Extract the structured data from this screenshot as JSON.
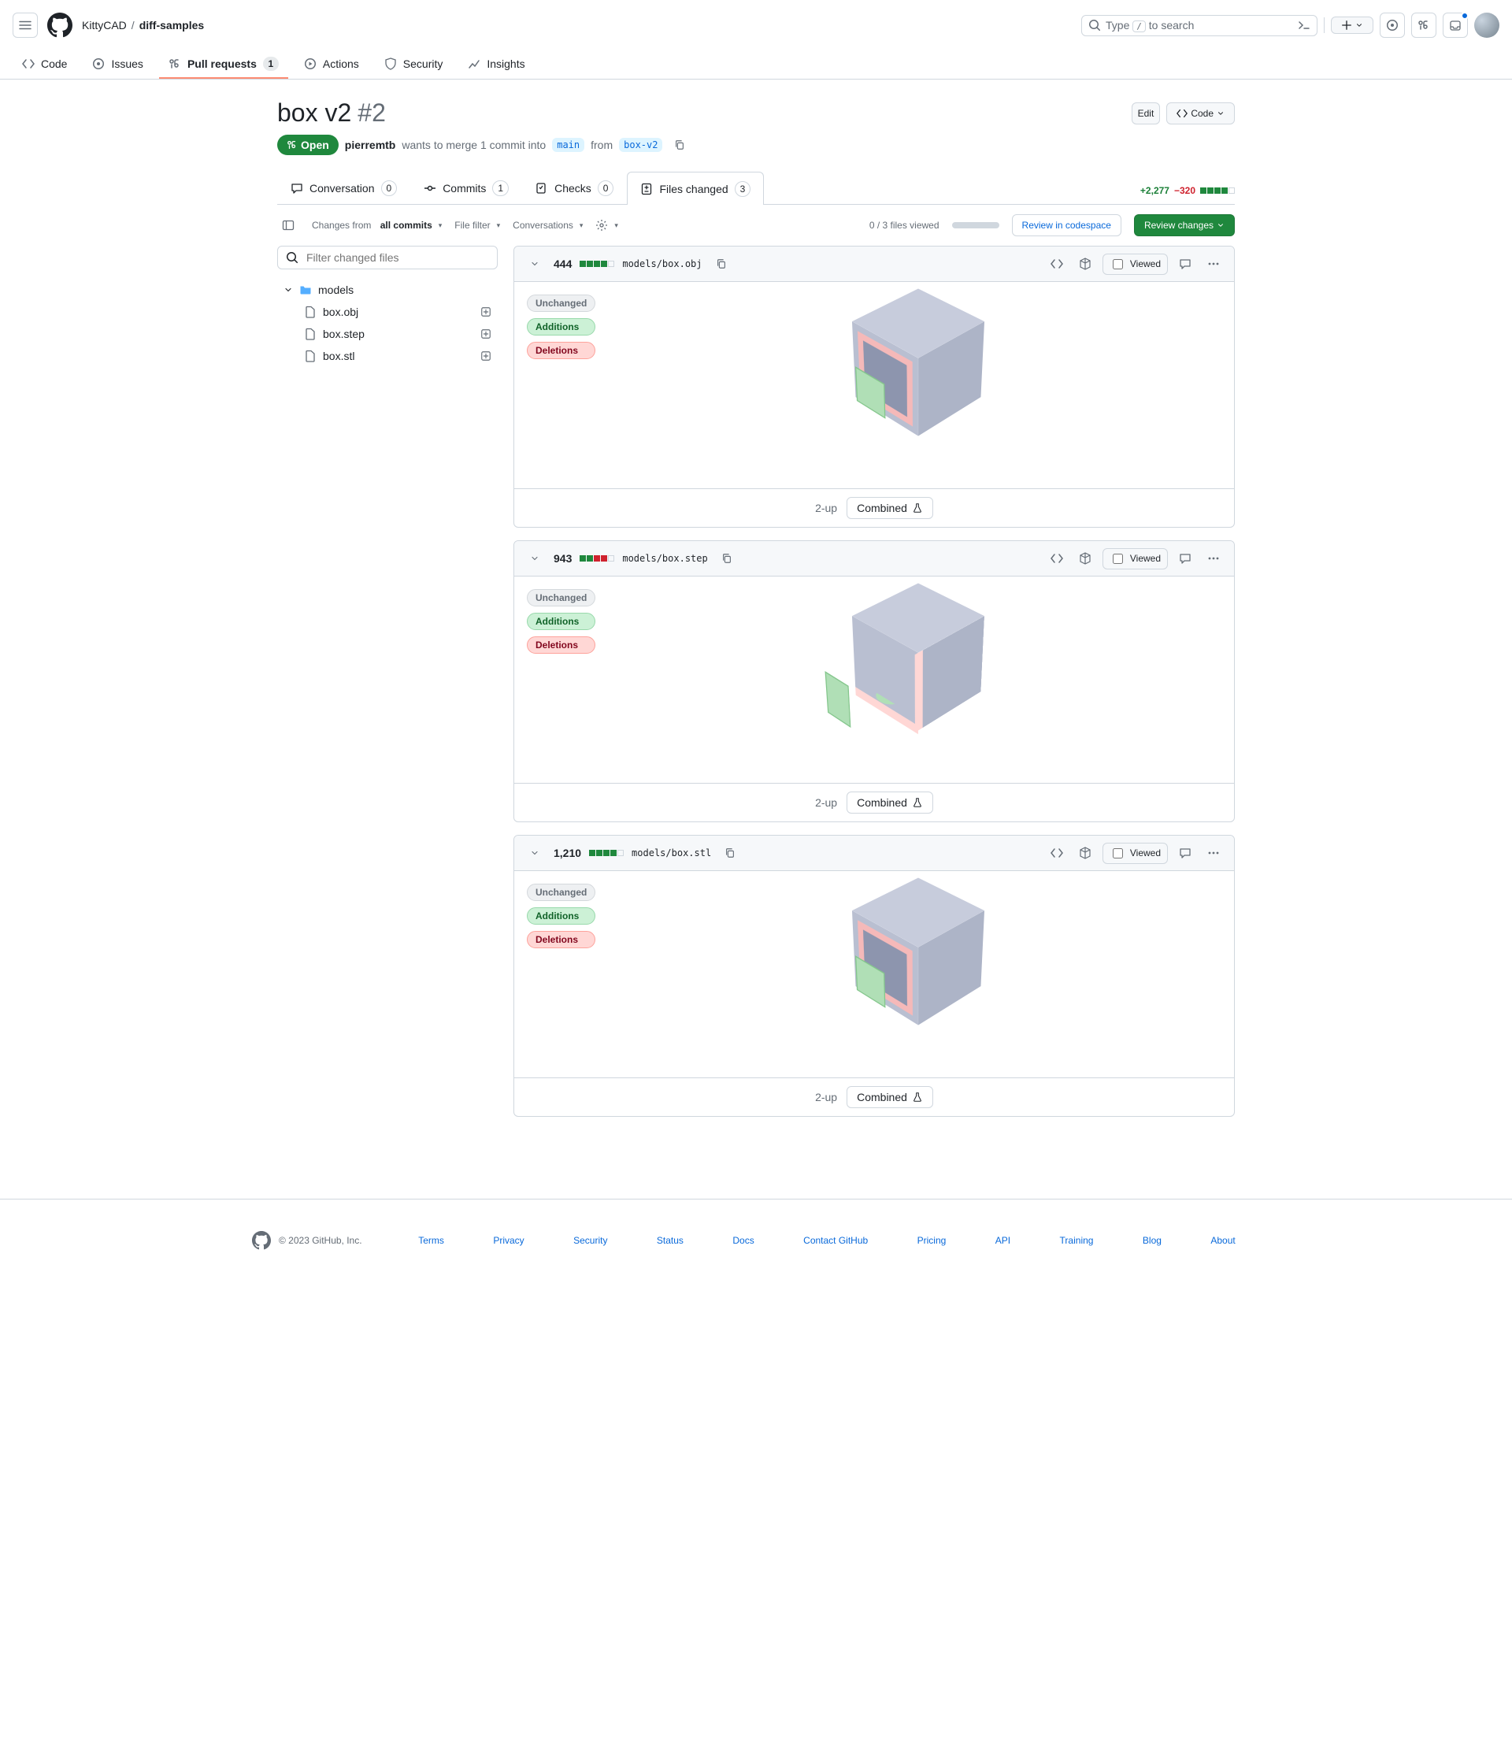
{
  "header": {
    "owner": "KittyCAD",
    "repo": "diff-samples",
    "search_prefix": "Type",
    "search_key": "/",
    "search_suffix": "to search"
  },
  "repo_nav": {
    "code": "Code",
    "issues": "Issues",
    "pulls": "Pull requests",
    "pulls_count": "1",
    "actions": "Actions",
    "security": "Security",
    "insights": "Insights"
  },
  "pr": {
    "title": "box v2",
    "number": "#2",
    "state": "Open",
    "author": "pierremtb",
    "meta": "wants to merge 1 commit into",
    "base_branch": "main",
    "from": "from",
    "head_branch": "box-v2",
    "edit": "Edit",
    "code_button": "Code"
  },
  "subnav": {
    "conversation": "Conversation",
    "conversation_count": "0",
    "commits": "Commits",
    "commits_count": "1",
    "checks": "Checks",
    "checks_count": "0",
    "files": "Files changed",
    "files_count": "3"
  },
  "diffstat": {
    "additions": "+2,277",
    "deletions": "−320"
  },
  "toolbar": {
    "changes_from_label": "Changes from",
    "changes_from_value": "all commits",
    "file_filter": "File filter",
    "conversations": "Conversations",
    "files_viewed": "0 / 3 files viewed",
    "review_codespace": "Review in codespace",
    "review_changes": "Review changes"
  },
  "sidebar": {
    "filter_placeholder": "Filter changed files",
    "folder": "models",
    "files": [
      "box.obj",
      "box.step",
      "box.stl"
    ]
  },
  "legend": {
    "unchanged": "Unchanged",
    "additions": "Additions",
    "deletions": "Deletions"
  },
  "view_modes": {
    "two_up": "2-up",
    "combined": "Combined"
  },
  "files": [
    {
      "changes": "444",
      "squares": [
        "add",
        "add",
        "add",
        "add",
        "neutral"
      ],
      "path": "models/box.obj"
    },
    {
      "changes": "943",
      "squares": [
        "add",
        "add",
        "del",
        "del",
        "neutral"
      ],
      "path": "models/box.step"
    },
    {
      "changes": "1,210",
      "squares": [
        "add",
        "add",
        "add",
        "add",
        "neutral"
      ],
      "path": "models/box.stl"
    }
  ],
  "viewed": "Viewed",
  "footer": {
    "copyright": "© 2023 GitHub, Inc.",
    "links": [
      "Terms",
      "Privacy",
      "Security",
      "Status",
      "Docs",
      "Contact GitHub",
      "Pricing",
      "API",
      "Training",
      "Blog",
      "About"
    ]
  }
}
